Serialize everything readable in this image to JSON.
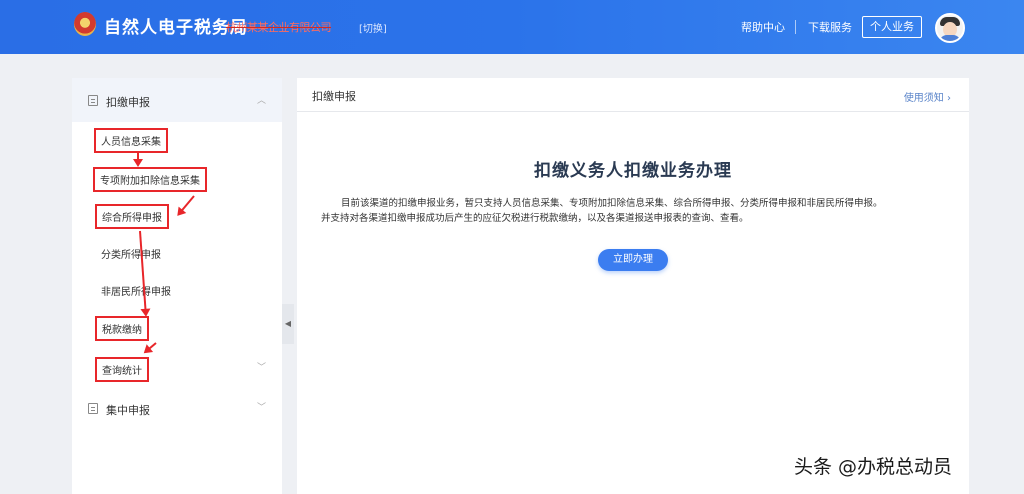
{
  "header": {
    "title": "自然人电子税务局",
    "org_name": "杭州某某企业有限公司",
    "switch_label": "[切换]",
    "help_label": "帮助中心",
    "download_label": "下载服务",
    "personal_label": "个人业务"
  },
  "sidebar": {
    "section1": {
      "title": "扣缴申报",
      "expanded": true
    },
    "items": [
      {
        "label": "人员信息采集",
        "highlighted": true
      },
      {
        "label": "专项附加扣除信息采集",
        "highlighted": true
      },
      {
        "label": "综合所得申报",
        "highlighted": true
      },
      {
        "label": "分类所得申报",
        "highlighted": false
      },
      {
        "label": "非居民所得申报",
        "highlighted": false
      },
      {
        "label": "税款缴纳",
        "highlighted": true
      },
      {
        "label": "查询统计",
        "highlighted": true
      }
    ],
    "section2": {
      "title": "集中申报",
      "expanded": false
    }
  },
  "main": {
    "title": "扣缴申报",
    "notice_label": "使用须知",
    "heading": "扣缴义务人扣缴业务办理",
    "desc_line1": "目前该渠道的扣缴申报业务，暂只支持人员信息采集、专项附加扣除信息采集、综合所得申报、分类所得申报和非居民所得申报。",
    "desc_line2": "并支持对各渠道扣缴申报成功后产生的应征欠税进行税款缴纳，以及各渠道报送申报表的查询、查看。",
    "action_label": "立即办理"
  },
  "watermark": "头条 @办税总动员",
  "colors": {
    "topbar": "#2b73ea",
    "highlight": "#e8262a",
    "primary_button": "#3b7df0"
  }
}
